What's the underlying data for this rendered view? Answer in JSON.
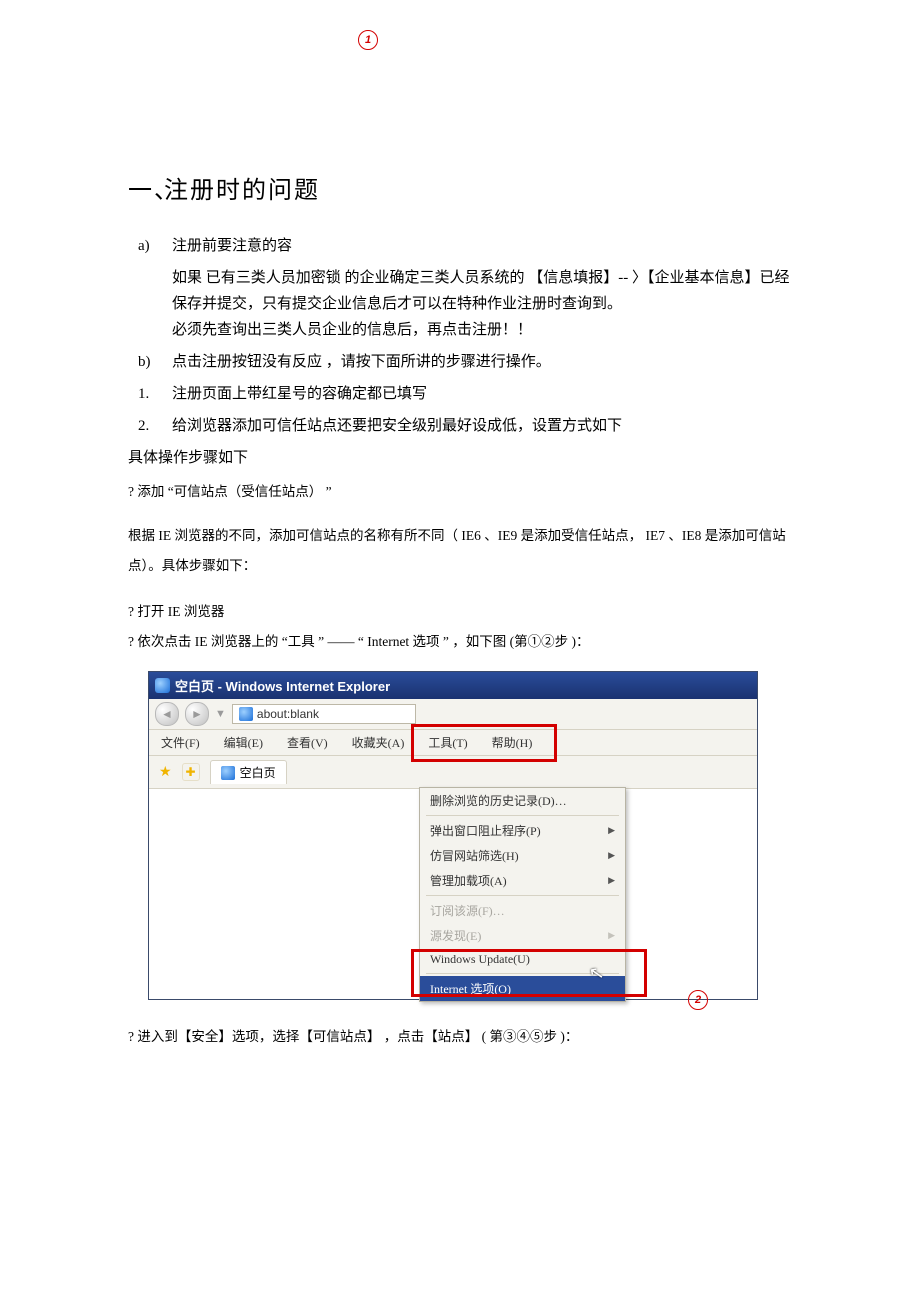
{
  "heading": {
    "num": "一、",
    "title": "注册时的问题"
  },
  "items": {
    "a_label": "a)",
    "a_title": "注册前要注意的容",
    "a_p1": "如果 已有三类人员加密锁 的企业确定三类人员系统的 【信息填报】-- 〉【企业基本信息】已经保存并提交，只有提交企业信息后才可以在特种作业注册时查询到。",
    "a_p2": "必须先查询出三类人员企业的信息后，再点击注册！！",
    "b_label": "b)",
    "b_title": "点击注册按钮没有反应  ，请按下面所讲的步骤进行操作。",
    "n1_label": "1.",
    "n1_title": "注册页面上带红星号的容确定都已填写",
    "n2_label": "2.",
    "n2_title": "给浏览器添加可信任站点还要把安全级别最好设成低，设置方式如下",
    "spec": "具体操作步骤如下",
    "q1": "?   添加 “可信站点（受信任站点）    ”",
    "para": "根据 IE 浏览器的不同，添加可信站点的名称有所不同（      IE6 、IE9 是添加受信任站点，   IE7 、IE8 是添加可信站点）。具体步骤如下：",
    "q2": "?   打开 IE 浏览器",
    "q3": "?   依次点击  IE 浏览器上的 “工具 ” —— “ Internet 选项 ” ，如下图 (第①②步 )：",
    "after": "? 进入到【安全】选项，选择【可信站点】     ，点击【站点】  ( 第③④⑤步 )："
  },
  "ie": {
    "title": "空白页 - Windows Internet Explorer",
    "addr": "about:blank",
    "menu": {
      "file": "文件(F)",
      "edit": "编辑(E)",
      "view": "查看(V)",
      "fav": "收藏夹(A)",
      "tools": "工具(T)",
      "help": "帮助(H)"
    },
    "tab": "空白页",
    "dd": {
      "hist": "删除浏览的历史记录(D)…",
      "popup": "弹出窗口阻止程序(P)",
      "phish": "仿冒网站筛选(H)",
      "addon": "管理加载项(A)",
      "feed": "订阅该源(F)…",
      "disc": "源发现(E)",
      "wu": "Windows Update(U)",
      "opt": "Internet 选项(O)"
    },
    "c1": "1",
    "c2": "2"
  }
}
